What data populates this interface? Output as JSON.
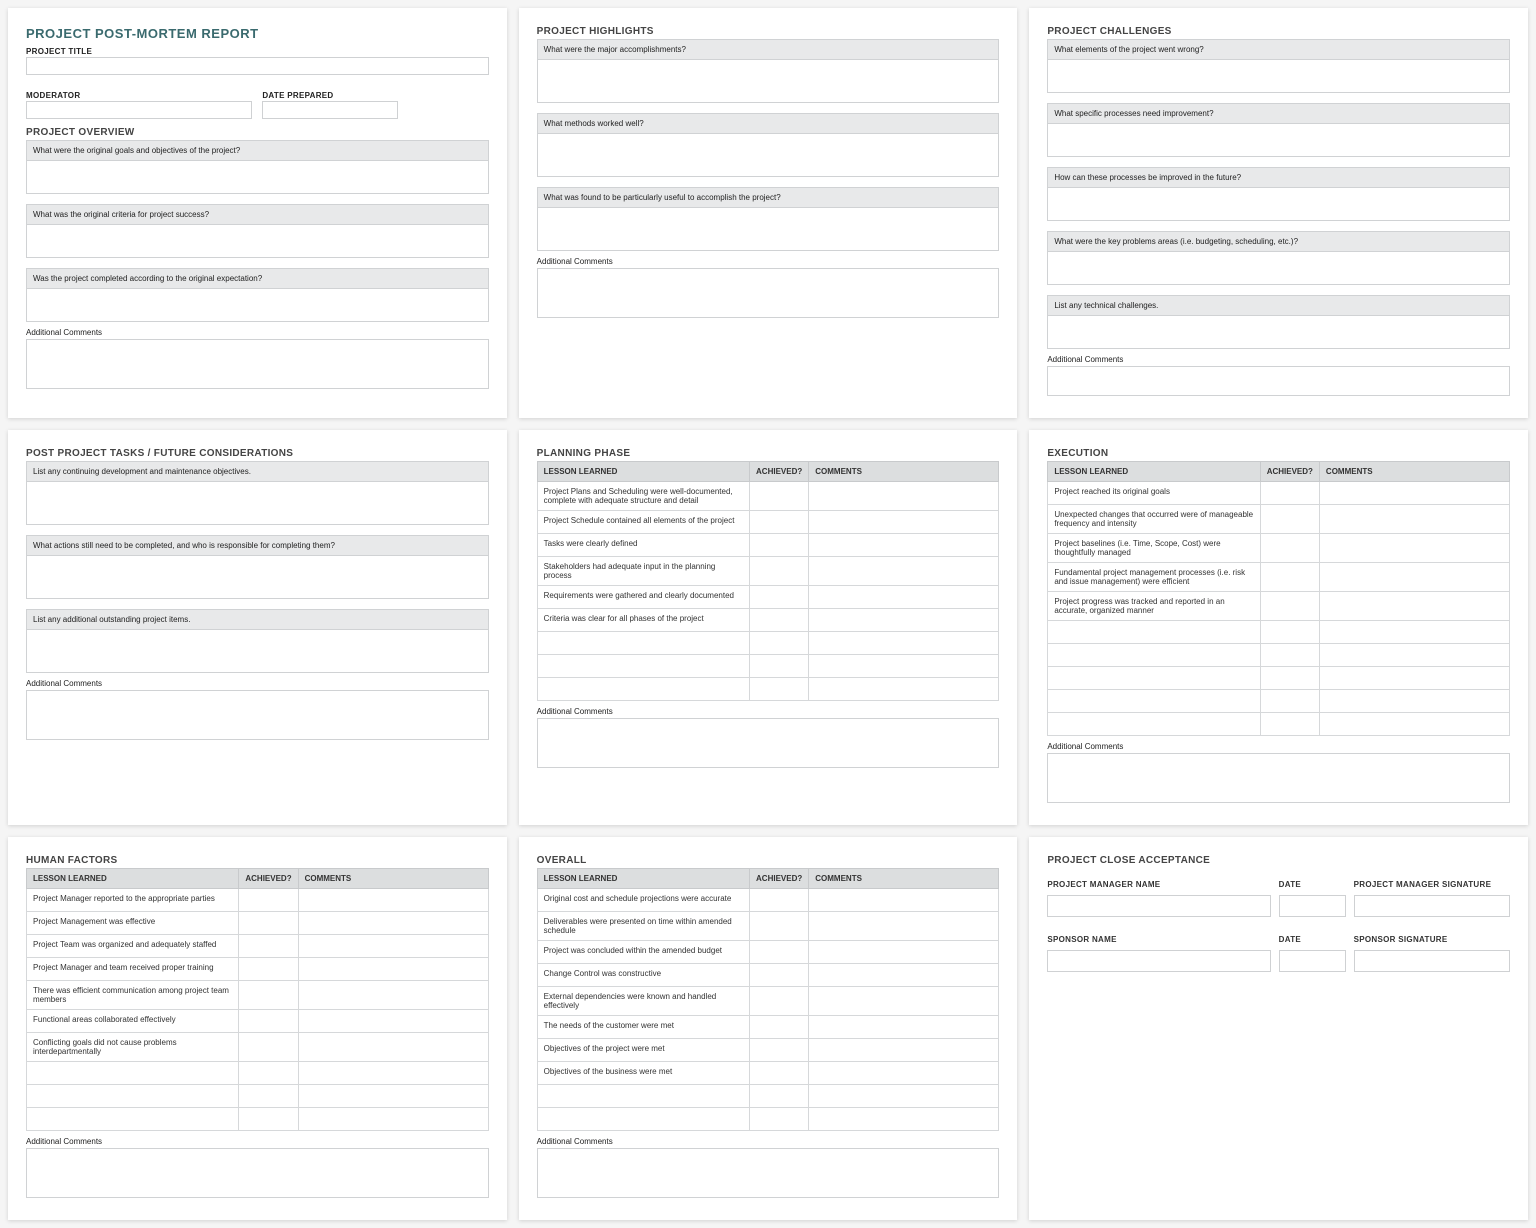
{
  "card1": {
    "title": "PROJECT POST-MORTEM REPORT",
    "project_title_label": "PROJECT TITLE",
    "moderator_label": "MODERATOR",
    "date_prepared_label": "DATE PREPARED",
    "overview_title": "PROJECT OVERVIEW",
    "q1": "What were the original goals and objectives of the project?",
    "q2": "What was the original criteria for project success?",
    "q3": "Was the project completed according to the original expectation?",
    "additional": "Additional Comments"
  },
  "card2": {
    "title": "PROJECT HIGHLIGHTS",
    "q1": "What were the major accomplishments?",
    "q2": "What methods worked well?",
    "q3": "What was found to be particularly useful to accomplish the project?",
    "additional": "Additional Comments"
  },
  "card3": {
    "title": "PROJECT CHALLENGES",
    "q1": "What elements of the project went wrong?",
    "q2": "What specific processes need improvement?",
    "q3": "How can these processes be improved in the future?",
    "q4": "What were the key problems areas (i.e. budgeting, scheduling, etc.)?",
    "q5": "List any technical challenges.",
    "additional": "Additional Comments"
  },
  "card4": {
    "title": "POST PROJECT TASKS / FUTURE CONSIDERATIONS",
    "q1": "List any continuing development and maintenance objectives.",
    "q2": "What actions still need to be completed, and who is responsible for completing them?",
    "q3": "List any additional outstanding project items.",
    "additional": "Additional Comments"
  },
  "card5": {
    "title": "PLANNING PHASE",
    "th": {
      "lesson": "LESSON LEARNED",
      "achieved": "ACHIEVED?",
      "comments": "COMMENTS"
    },
    "rows": [
      "Project Plans and Scheduling were well-documented, complete with adequate structure and detail",
      "Project Schedule contained all elements of the project",
      "Tasks were clearly defined",
      "Stakeholders had adequate input in the planning process",
      "Requirements were gathered and clearly documented",
      "Criteria was clear for all phases of the project",
      "",
      "",
      ""
    ],
    "additional": "Additional Comments"
  },
  "card6": {
    "title": "EXECUTION",
    "th": {
      "lesson": "LESSON LEARNED",
      "achieved": "ACHIEVED?",
      "comments": "COMMENTS"
    },
    "rows": [
      "Project reached its original goals",
      "Unexpected changes that occurred were of manageable frequency and intensity",
      "Project baselines (i.e. Time, Scope, Cost) were thoughtfully managed",
      "Fundamental project management processes (i.e. risk and issue management) were efficient",
      "Project progress was tracked and reported in an accurate, organized manner",
      "",
      "",
      "",
      "",
      ""
    ],
    "additional": "Additional Comments"
  },
  "card7": {
    "title": "HUMAN FACTORS",
    "th": {
      "lesson": "LESSON LEARNED",
      "achieved": "ACHIEVED?",
      "comments": "COMMENTS"
    },
    "rows": [
      "Project Manager reported to the appropriate parties",
      "Project Management was effective",
      "Project Team was organized and adequately staffed",
      "Project Manager and team received proper training",
      "There was efficient communication among project team members",
      "Functional areas collaborated effectively",
      "Conflicting goals did not cause problems interdepartmentally",
      "",
      "",
      ""
    ],
    "additional": "Additional Comments"
  },
  "card8": {
    "title": "OVERALL",
    "th": {
      "lesson": "LESSON LEARNED",
      "achieved": "ACHIEVED?",
      "comments": "COMMENTS"
    },
    "rows": [
      "Original cost and schedule projections were accurate",
      "Deliverables were presented on time within amended schedule",
      "Project was concluded within the amended budget",
      "Change Control was constructive",
      "External dependencies were known and handled effectively",
      "The needs of the customer were met",
      "Objectives of the project were met",
      "Objectives of the business were met",
      "",
      ""
    ],
    "additional": "Additional Comments"
  },
  "card9": {
    "title": "PROJECT CLOSE ACCEPTANCE",
    "pm_name": "PROJECT MANAGER NAME",
    "date": "DATE",
    "pm_sig": "PROJECT MANAGER SIGNATURE",
    "sponsor_name": "SPONSOR NAME",
    "sponsor_sig": "SPONSOR SIGNATURE"
  }
}
